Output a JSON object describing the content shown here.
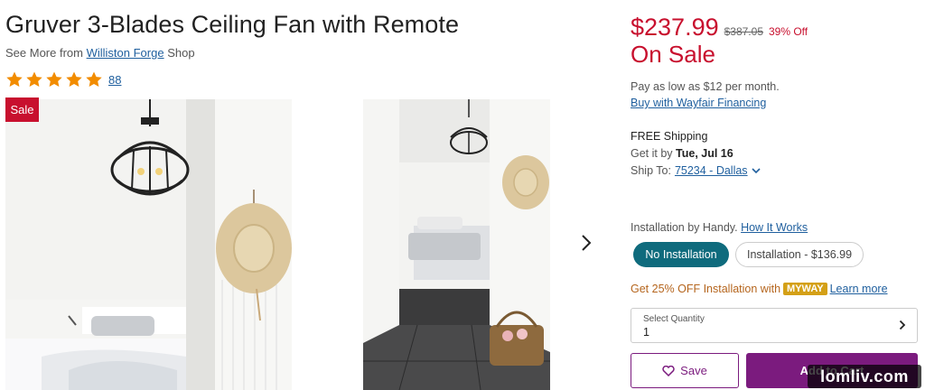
{
  "product": {
    "title": "Gruver 3-Blades Ceiling Fan with Remote",
    "see_more_prefix": "See More from",
    "brand_link": "Williston Forge",
    "see_more_suffix": "Shop",
    "rating": 5,
    "review_count": "88",
    "sale_badge": "Sale"
  },
  "gallery": {
    "image_count": 2,
    "next_icon": "chevron-right-icon"
  },
  "pricing": {
    "price": "$237.99",
    "original_price": "$387.05",
    "discount": "39% Off",
    "sale_label": "On Sale",
    "financing_text": "Pay as low as $12 per month.",
    "financing_link": "Buy with Wayfair Financing"
  },
  "shipping": {
    "free_label": "FREE Shipping",
    "get_it_prefix": "Get it by",
    "date": "Tue, Jul 16",
    "ship_to_prefix": "Ship To:",
    "location": "75234 - Dallas"
  },
  "installation": {
    "label": "Installation by Handy.",
    "how_link": "How It Works",
    "options": [
      {
        "label": "No Installation",
        "selected": true
      },
      {
        "label": "Installation - $136.99",
        "selected": false
      }
    ]
  },
  "promo": {
    "text": "Get 25% OFF Installation with",
    "badge": "MYWAY",
    "link": "Learn more"
  },
  "quantity": {
    "label": "Select Quantity",
    "value": "1"
  },
  "actions": {
    "save_label": "Save",
    "cart_label": "Add to Cart"
  },
  "watermark": "lomliv.com",
  "colors": {
    "sale_red": "#c8102e",
    "link_blue": "#1f5f9e",
    "teal": "#0f6b7d",
    "purple": "#7b1b7e",
    "star_orange": "#f28c00",
    "myway_gold": "#d4a017"
  }
}
